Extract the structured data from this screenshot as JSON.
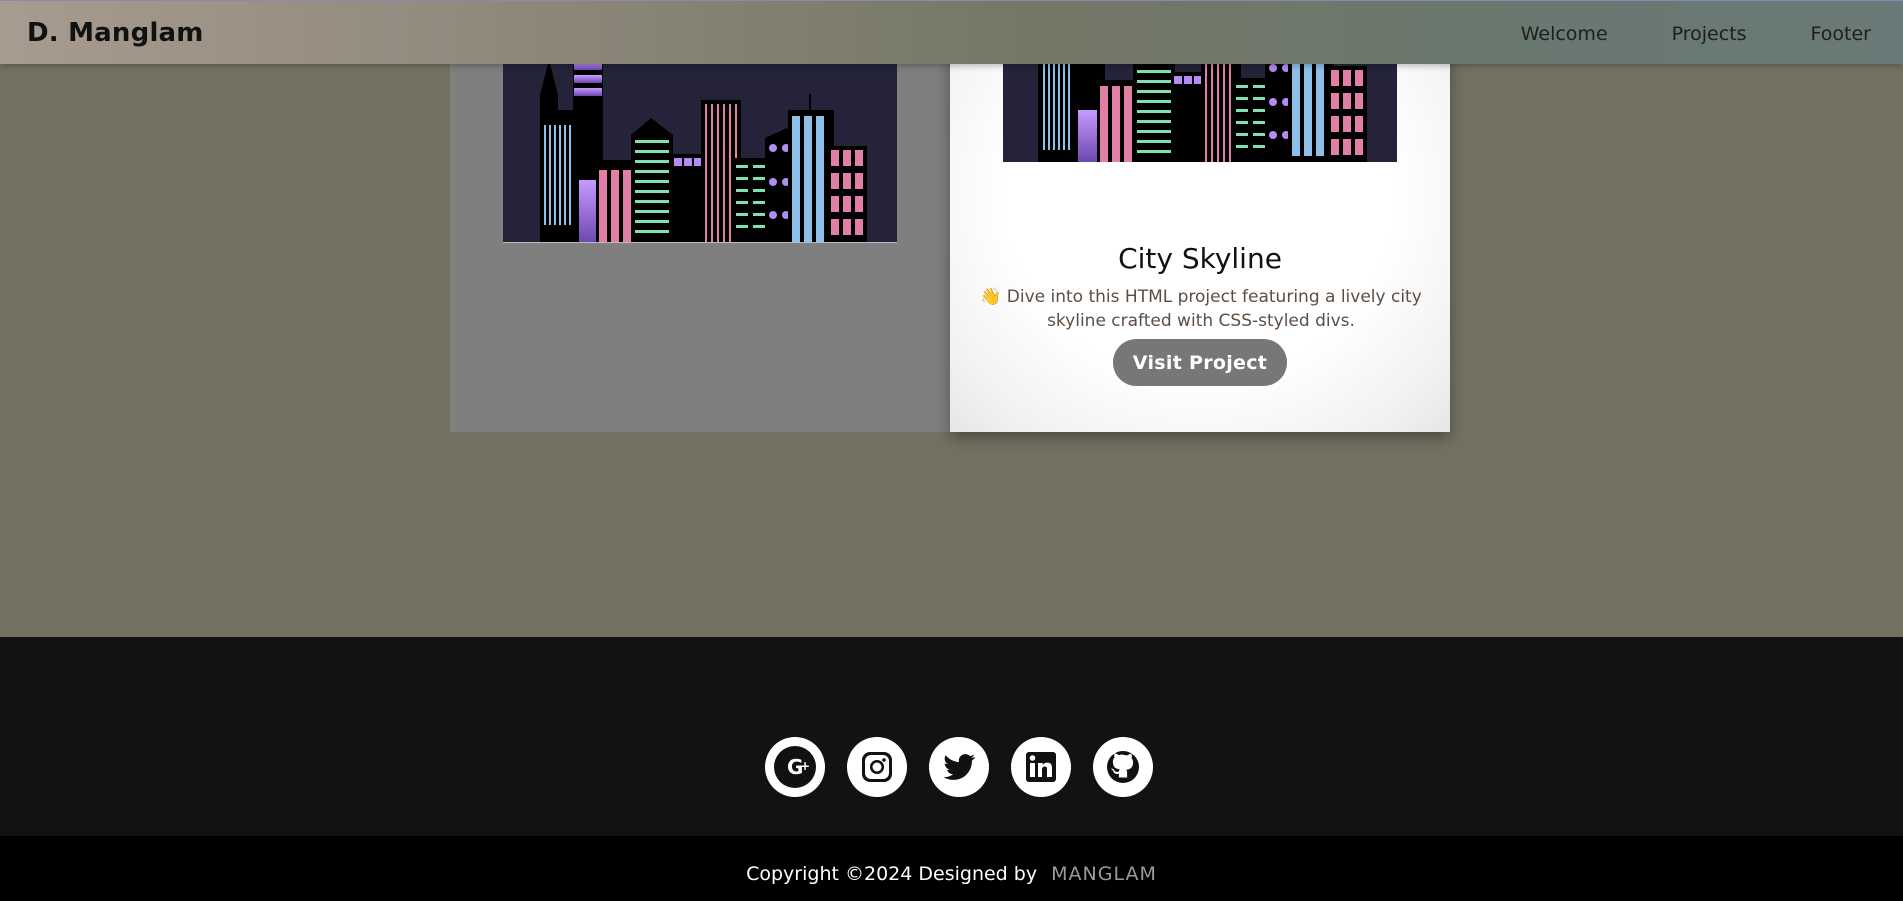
{
  "navbar": {
    "brand": "D. Manglam",
    "links": [
      "Welcome",
      "Projects",
      "Footer"
    ]
  },
  "projects": {
    "card_right": {
      "title": "City Skyline",
      "emoji": "👋",
      "description": "Dive into this HTML project featuring a lively city skyline crafted with CSS-styled divs.",
      "button": "Visit Project"
    }
  },
  "footer": {
    "social_icons": [
      "google-plus-icon",
      "instagram-icon",
      "twitter-icon",
      "linkedin-icon",
      "github-icon"
    ],
    "copyright_text": "Copyright ©2024 Designed by",
    "author": "MANGLAM"
  },
  "colors": {
    "page_bg": "#737261",
    "card_left_bg": "#7f7f7f",
    "button_bg": "#777777",
    "footer_bg": "#121212",
    "skyline_bg": "#24233a",
    "building_pink": "#e27fa6",
    "building_green": "#7fe0b2",
    "building_blue": "#8ec0ea",
    "building_purple": "#b48af5"
  }
}
